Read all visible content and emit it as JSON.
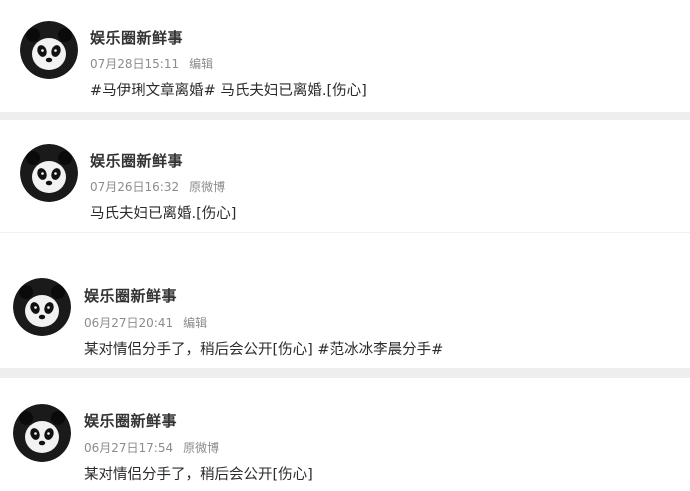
{
  "posts": [
    {
      "author": "娱乐圈新鲜事",
      "time": "07月28日15:11",
      "source": "编辑",
      "content": "#马伊琍文章离婚# 马氏夫妇已离婚.[伤心]",
      "avatar_icon": "panda-icon"
    },
    {
      "author": "娱乐圈新鲜事",
      "time": "07月26日16:32",
      "source": "原微博",
      "content": "马氏夫妇已离婚.[伤心]",
      "avatar_icon": "panda-icon"
    },
    {
      "author": "娱乐圈新鲜事",
      "time": "06月27日20:41",
      "source": "编辑",
      "content": "某对情侣分手了，稍后会公开[伤心] #范冰冰李晨分手#",
      "avatar_icon": "panda-icon"
    },
    {
      "author": "娱乐圈新鲜事",
      "time": "06月27日17:54",
      "source": "原微博",
      "content": "某对情侣分手了，稍后会公开[伤心]",
      "avatar_icon": "panda-icon"
    }
  ]
}
